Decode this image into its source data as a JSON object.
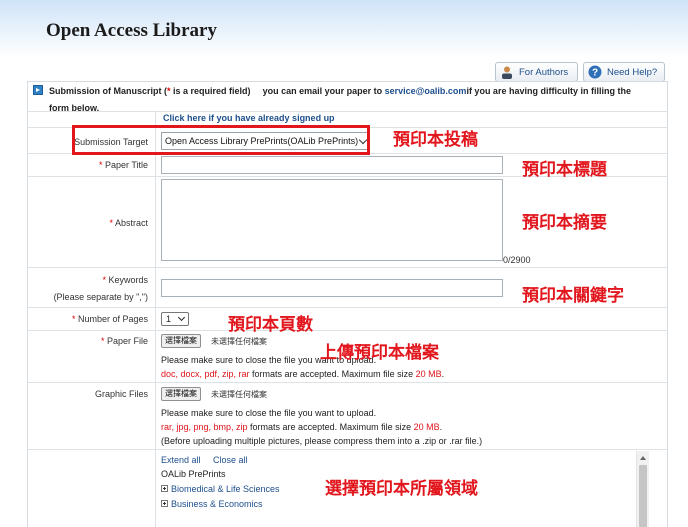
{
  "header": {
    "title": "Open Access Library"
  },
  "top_buttons": {
    "for_authors": "For Authors",
    "need_help": "Need Help?"
  },
  "banner": {
    "title": "Submission of Manuscript (",
    "req_star": "*",
    "title_tail": " is a required field)",
    "email_prefix": "you can email your paper to ",
    "email": "service@oalib.com",
    "email_suffix": "if you are having difficulty in filling the",
    "line2": "form below."
  },
  "form": {
    "signed_link": "Click here if you have already signed up",
    "target_label": "Submission Target",
    "target_value": "Open Access Library PrePrints(OALib PrePrints)",
    "title_label": " Paper Title",
    "abstract_label": " Abstract",
    "abstract_count": "0/2900",
    "keywords_label": " Keywords",
    "keywords_hint": "(Please separate by \",\")",
    "pages_label": " Number of Pages",
    "pages_value": "1",
    "paper_file_label": " Paper File",
    "choose_file": "選擇檔案",
    "no_file": "未選擇任何檔案",
    "paper_note": "Please make sure to close the file you want to upload.",
    "paper_formats": "doc, docx, pdf, zip, rar",
    "paper_formats_tail": " formats are accepted. Maximum file size ",
    "paper_max": "20 MB",
    "graphic_label": "Graphic Files",
    "graphic_note": "Please make sure to close the file you want to upload.",
    "graphic_formats": "rar, jpg, png, bmp, zip",
    "graphic_formats_tail": " formats are accepted. Maximum file size ",
    "graphic_max": "20 MB",
    "graphic_note2": "(Before uploading multiple pictures, please compress them into a .zip or .rar file.)",
    "required_star": "*",
    "period": "."
  },
  "domains": {
    "extend_all": "Extend all",
    "close_all": "Close all",
    "root": "OALib PrePrints",
    "items": [
      "Biomedical & Life Sciences",
      "Business & Economics"
    ]
  },
  "annotations": {
    "target": "預印本投稿",
    "title": "預印本標題",
    "abstract": "預印本摘要",
    "keywords": "預印本關鍵字",
    "pages": "預印本頁數",
    "upload": "上傳預印本檔案",
    "domain": "選擇預印本所屬領域"
  },
  "colors": {
    "accent_link": "#1e4f8c",
    "required": "#d00000",
    "annotation": "#e2161d"
  }
}
